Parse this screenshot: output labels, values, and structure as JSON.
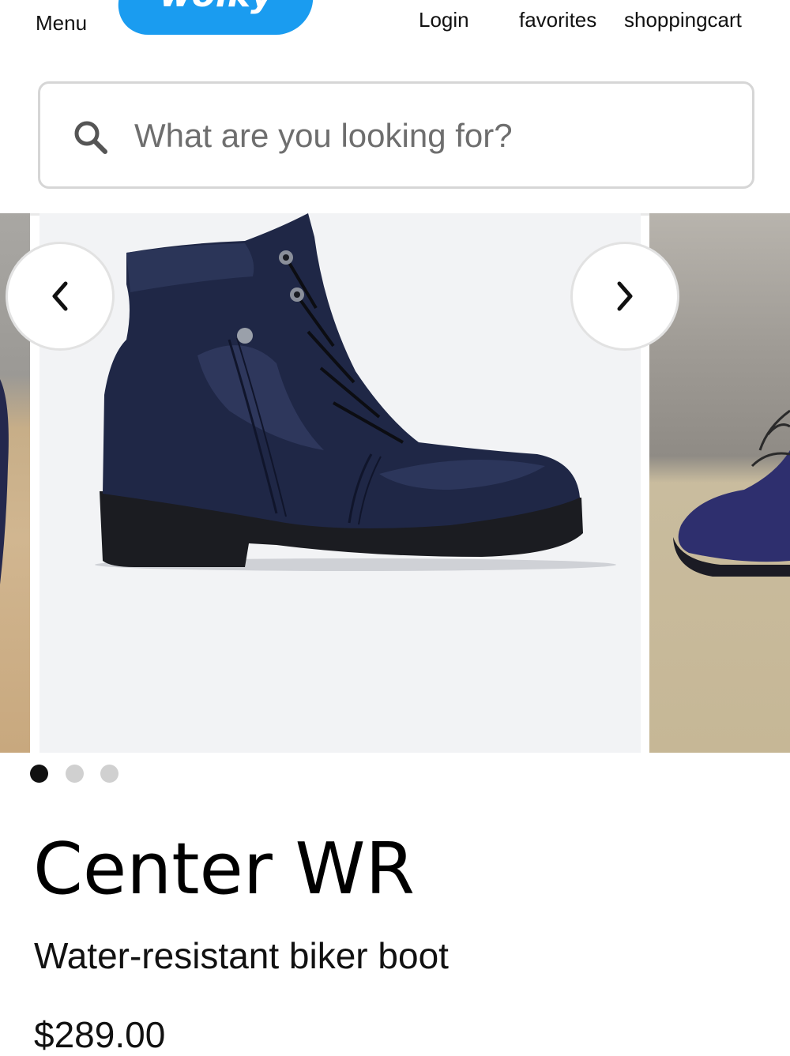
{
  "header": {
    "menu_label": "Menu",
    "logo_text": "wolky",
    "login_label": "Login",
    "favorites_label": "favorites",
    "cart_label": "shoppingcart",
    "brand_color": "#1a9cf0"
  },
  "search": {
    "placeholder": "What are you looking for?",
    "icon": "search-icon"
  },
  "carousel": {
    "prev_icon": "chevron-left-icon",
    "next_icon": "chevron-right-icon",
    "total_slides": 3,
    "active_slide": 1
  },
  "product": {
    "title": "Center WR",
    "subtitle": "Water-resistant biker boot",
    "price": "$289.00",
    "color": "navy blue leather"
  }
}
